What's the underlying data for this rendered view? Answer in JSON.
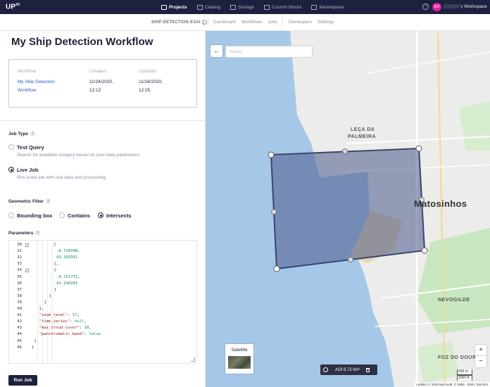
{
  "app": {
    "logo": "UP",
    "logo_sup": "42"
  },
  "topnav": {
    "items": [
      {
        "label": "Projects",
        "icon": "folder-icon",
        "active": true
      },
      {
        "label": "Catalog",
        "icon": "catalog-icon"
      },
      {
        "label": "Storage",
        "icon": "storage-icon"
      },
      {
        "label": "Custom blocks",
        "icon": "blocks-icon"
      },
      {
        "label": "Marketplace",
        "icon": "marketplace-icon"
      }
    ],
    "help": "?",
    "avatar_initials": "CV",
    "workspace_label": "'s Workspace"
  },
  "subnav": {
    "project": "SHIP DETECTION EXAI",
    "links_a": [
      "Dashboard",
      "Workflows",
      "Jobs"
    ],
    "links_b": [
      "Developers",
      "Settings"
    ]
  },
  "page": {
    "title": "My Ship Detection Workflow"
  },
  "info_card": {
    "workflow_label": "Workflow",
    "workflow_line1": "My Ship Detection",
    "workflow_line2": "Workflow",
    "created_label": "Created",
    "created_date": "11/24/2020,",
    "created_time": "12:12",
    "updated_label": "Updated",
    "updated_date": "11/24/2020,",
    "updated_time": "12:25"
  },
  "job_type": {
    "label": "Job Type",
    "options": [
      {
        "title": "Test Query",
        "desc": "Search for available imagery based on your data parameters.",
        "selected": false
      },
      {
        "title": "Live Job",
        "desc": "Run a live job with real data and processing.",
        "selected": true
      }
    ]
  },
  "geometric_filter": {
    "label": "Geometric Filter",
    "options": [
      {
        "label": "Bounding box",
        "selected": false
      },
      {
        "label": "Contains",
        "selected": false
      },
      {
        "label": "Intersects",
        "selected": true
      }
    ]
  },
  "parameters": {
    "label": "Parameters",
    "lines": [
      {
        "n": "30",
        "fold": true,
        "indent": 9,
        "text": "["
      },
      {
        "n": "31",
        "indent": 10,
        "text": "-8.720398,",
        "kind": "num"
      },
      {
        "n": "32",
        "indent": 10,
        "text": "41.169351",
        "kind": "num"
      },
      {
        "n": "33",
        "indent": 9,
        "text": "],"
      },
      {
        "n": "34",
        "fold": true,
        "indent": 9,
        "text": "["
      },
      {
        "n": "35",
        "indent": 10,
        "text": "-8.721771,",
        "kind": "num"
      },
      {
        "n": "36",
        "indent": 10,
        "text": "41.190281",
        "kind": "num"
      },
      {
        "n": "37",
        "indent": 9,
        "text": "]"
      },
      {
        "n": "38",
        "indent": 7,
        "text": "]"
      },
      {
        "n": "39",
        "indent": 5,
        "text": "]"
      },
      {
        "n": "40",
        "indent": 3,
        "text": "},"
      },
      {
        "n": "41",
        "indent": 3,
        "key": "\"zoom_level\"",
        "val": "17",
        "vkind": "num"
      },
      {
        "n": "42",
        "indent": 3,
        "key": "\"time_series\"",
        "val": "null",
        "vkind": "num"
      },
      {
        "n": "43",
        "indent": 3,
        "key": "\"max_cloud_cover\"",
        "val": "10",
        "vkind": "num"
      },
      {
        "n": "44",
        "indent": 3,
        "key": "\"panchromatic_band\"",
        "val": "false",
        "vkind": "num",
        "last": true
      },
      {
        "n": "45",
        "indent": 1,
        "text": "}"
      },
      {
        "n": "46",
        "indent": 0,
        "text": "}"
      }
    ]
  },
  "run_button": "Run Job",
  "map": {
    "back": "←",
    "search_placeholder": "Search...",
    "labels": {
      "leca1": "LEÇA DA",
      "leca2": "PALMEIRA",
      "matosinhos": "Matosinhos",
      "nevogilde": "NEVOGILDE",
      "foz": "FOZ DO DOURO"
    },
    "satellite_label": "Satellite",
    "aoi_label": "AOI 6.72 km²",
    "zoom_in": "+",
    "zoom_out": "−",
    "scale_top": "500 m",
    "scale_bottom": "2000 ft",
    "attribution": "Leaflet | © 2020 Microsoft, © 1990 - 2020, TomTom",
    "colors": {
      "water": "#a6c8e8",
      "land": "#ececea",
      "aoi_fill": "#4a5a8a",
      "aoi_stroke": "#3b4570"
    }
  }
}
